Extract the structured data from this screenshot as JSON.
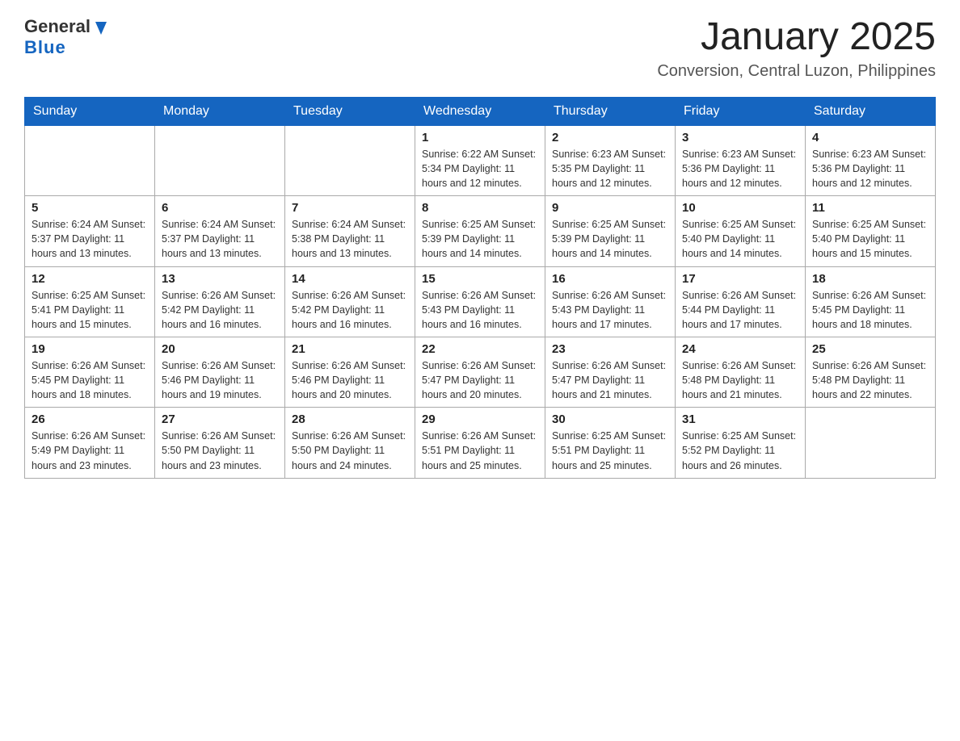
{
  "header": {
    "logo": {
      "general": "General",
      "blue": "Blue"
    },
    "title": "January 2025",
    "location": "Conversion, Central Luzon, Philippines"
  },
  "weekdays": [
    "Sunday",
    "Monday",
    "Tuesday",
    "Wednesday",
    "Thursday",
    "Friday",
    "Saturday"
  ],
  "weeks": [
    [
      {
        "day": "",
        "info": ""
      },
      {
        "day": "",
        "info": ""
      },
      {
        "day": "",
        "info": ""
      },
      {
        "day": "1",
        "info": "Sunrise: 6:22 AM\nSunset: 5:34 PM\nDaylight: 11 hours and 12 minutes."
      },
      {
        "day": "2",
        "info": "Sunrise: 6:23 AM\nSunset: 5:35 PM\nDaylight: 11 hours and 12 minutes."
      },
      {
        "day": "3",
        "info": "Sunrise: 6:23 AM\nSunset: 5:36 PM\nDaylight: 11 hours and 12 minutes."
      },
      {
        "day": "4",
        "info": "Sunrise: 6:23 AM\nSunset: 5:36 PM\nDaylight: 11 hours and 12 minutes."
      }
    ],
    [
      {
        "day": "5",
        "info": "Sunrise: 6:24 AM\nSunset: 5:37 PM\nDaylight: 11 hours and 13 minutes."
      },
      {
        "day": "6",
        "info": "Sunrise: 6:24 AM\nSunset: 5:37 PM\nDaylight: 11 hours and 13 minutes."
      },
      {
        "day": "7",
        "info": "Sunrise: 6:24 AM\nSunset: 5:38 PM\nDaylight: 11 hours and 13 minutes."
      },
      {
        "day": "8",
        "info": "Sunrise: 6:25 AM\nSunset: 5:39 PM\nDaylight: 11 hours and 14 minutes."
      },
      {
        "day": "9",
        "info": "Sunrise: 6:25 AM\nSunset: 5:39 PM\nDaylight: 11 hours and 14 minutes."
      },
      {
        "day": "10",
        "info": "Sunrise: 6:25 AM\nSunset: 5:40 PM\nDaylight: 11 hours and 14 minutes."
      },
      {
        "day": "11",
        "info": "Sunrise: 6:25 AM\nSunset: 5:40 PM\nDaylight: 11 hours and 15 minutes."
      }
    ],
    [
      {
        "day": "12",
        "info": "Sunrise: 6:25 AM\nSunset: 5:41 PM\nDaylight: 11 hours and 15 minutes."
      },
      {
        "day": "13",
        "info": "Sunrise: 6:26 AM\nSunset: 5:42 PM\nDaylight: 11 hours and 16 minutes."
      },
      {
        "day": "14",
        "info": "Sunrise: 6:26 AM\nSunset: 5:42 PM\nDaylight: 11 hours and 16 minutes."
      },
      {
        "day": "15",
        "info": "Sunrise: 6:26 AM\nSunset: 5:43 PM\nDaylight: 11 hours and 16 minutes."
      },
      {
        "day": "16",
        "info": "Sunrise: 6:26 AM\nSunset: 5:43 PM\nDaylight: 11 hours and 17 minutes."
      },
      {
        "day": "17",
        "info": "Sunrise: 6:26 AM\nSunset: 5:44 PM\nDaylight: 11 hours and 17 minutes."
      },
      {
        "day": "18",
        "info": "Sunrise: 6:26 AM\nSunset: 5:45 PM\nDaylight: 11 hours and 18 minutes."
      }
    ],
    [
      {
        "day": "19",
        "info": "Sunrise: 6:26 AM\nSunset: 5:45 PM\nDaylight: 11 hours and 18 minutes."
      },
      {
        "day": "20",
        "info": "Sunrise: 6:26 AM\nSunset: 5:46 PM\nDaylight: 11 hours and 19 minutes."
      },
      {
        "day": "21",
        "info": "Sunrise: 6:26 AM\nSunset: 5:46 PM\nDaylight: 11 hours and 20 minutes."
      },
      {
        "day": "22",
        "info": "Sunrise: 6:26 AM\nSunset: 5:47 PM\nDaylight: 11 hours and 20 minutes."
      },
      {
        "day": "23",
        "info": "Sunrise: 6:26 AM\nSunset: 5:47 PM\nDaylight: 11 hours and 21 minutes."
      },
      {
        "day": "24",
        "info": "Sunrise: 6:26 AM\nSunset: 5:48 PM\nDaylight: 11 hours and 21 minutes."
      },
      {
        "day": "25",
        "info": "Sunrise: 6:26 AM\nSunset: 5:48 PM\nDaylight: 11 hours and 22 minutes."
      }
    ],
    [
      {
        "day": "26",
        "info": "Sunrise: 6:26 AM\nSunset: 5:49 PM\nDaylight: 11 hours and 23 minutes."
      },
      {
        "day": "27",
        "info": "Sunrise: 6:26 AM\nSunset: 5:50 PM\nDaylight: 11 hours and 23 minutes."
      },
      {
        "day": "28",
        "info": "Sunrise: 6:26 AM\nSunset: 5:50 PM\nDaylight: 11 hours and 24 minutes."
      },
      {
        "day": "29",
        "info": "Sunrise: 6:26 AM\nSunset: 5:51 PM\nDaylight: 11 hours and 25 minutes."
      },
      {
        "day": "30",
        "info": "Sunrise: 6:25 AM\nSunset: 5:51 PM\nDaylight: 11 hours and 25 minutes."
      },
      {
        "day": "31",
        "info": "Sunrise: 6:25 AM\nSunset: 5:52 PM\nDaylight: 11 hours and 26 minutes."
      },
      {
        "day": "",
        "info": ""
      }
    ]
  ]
}
